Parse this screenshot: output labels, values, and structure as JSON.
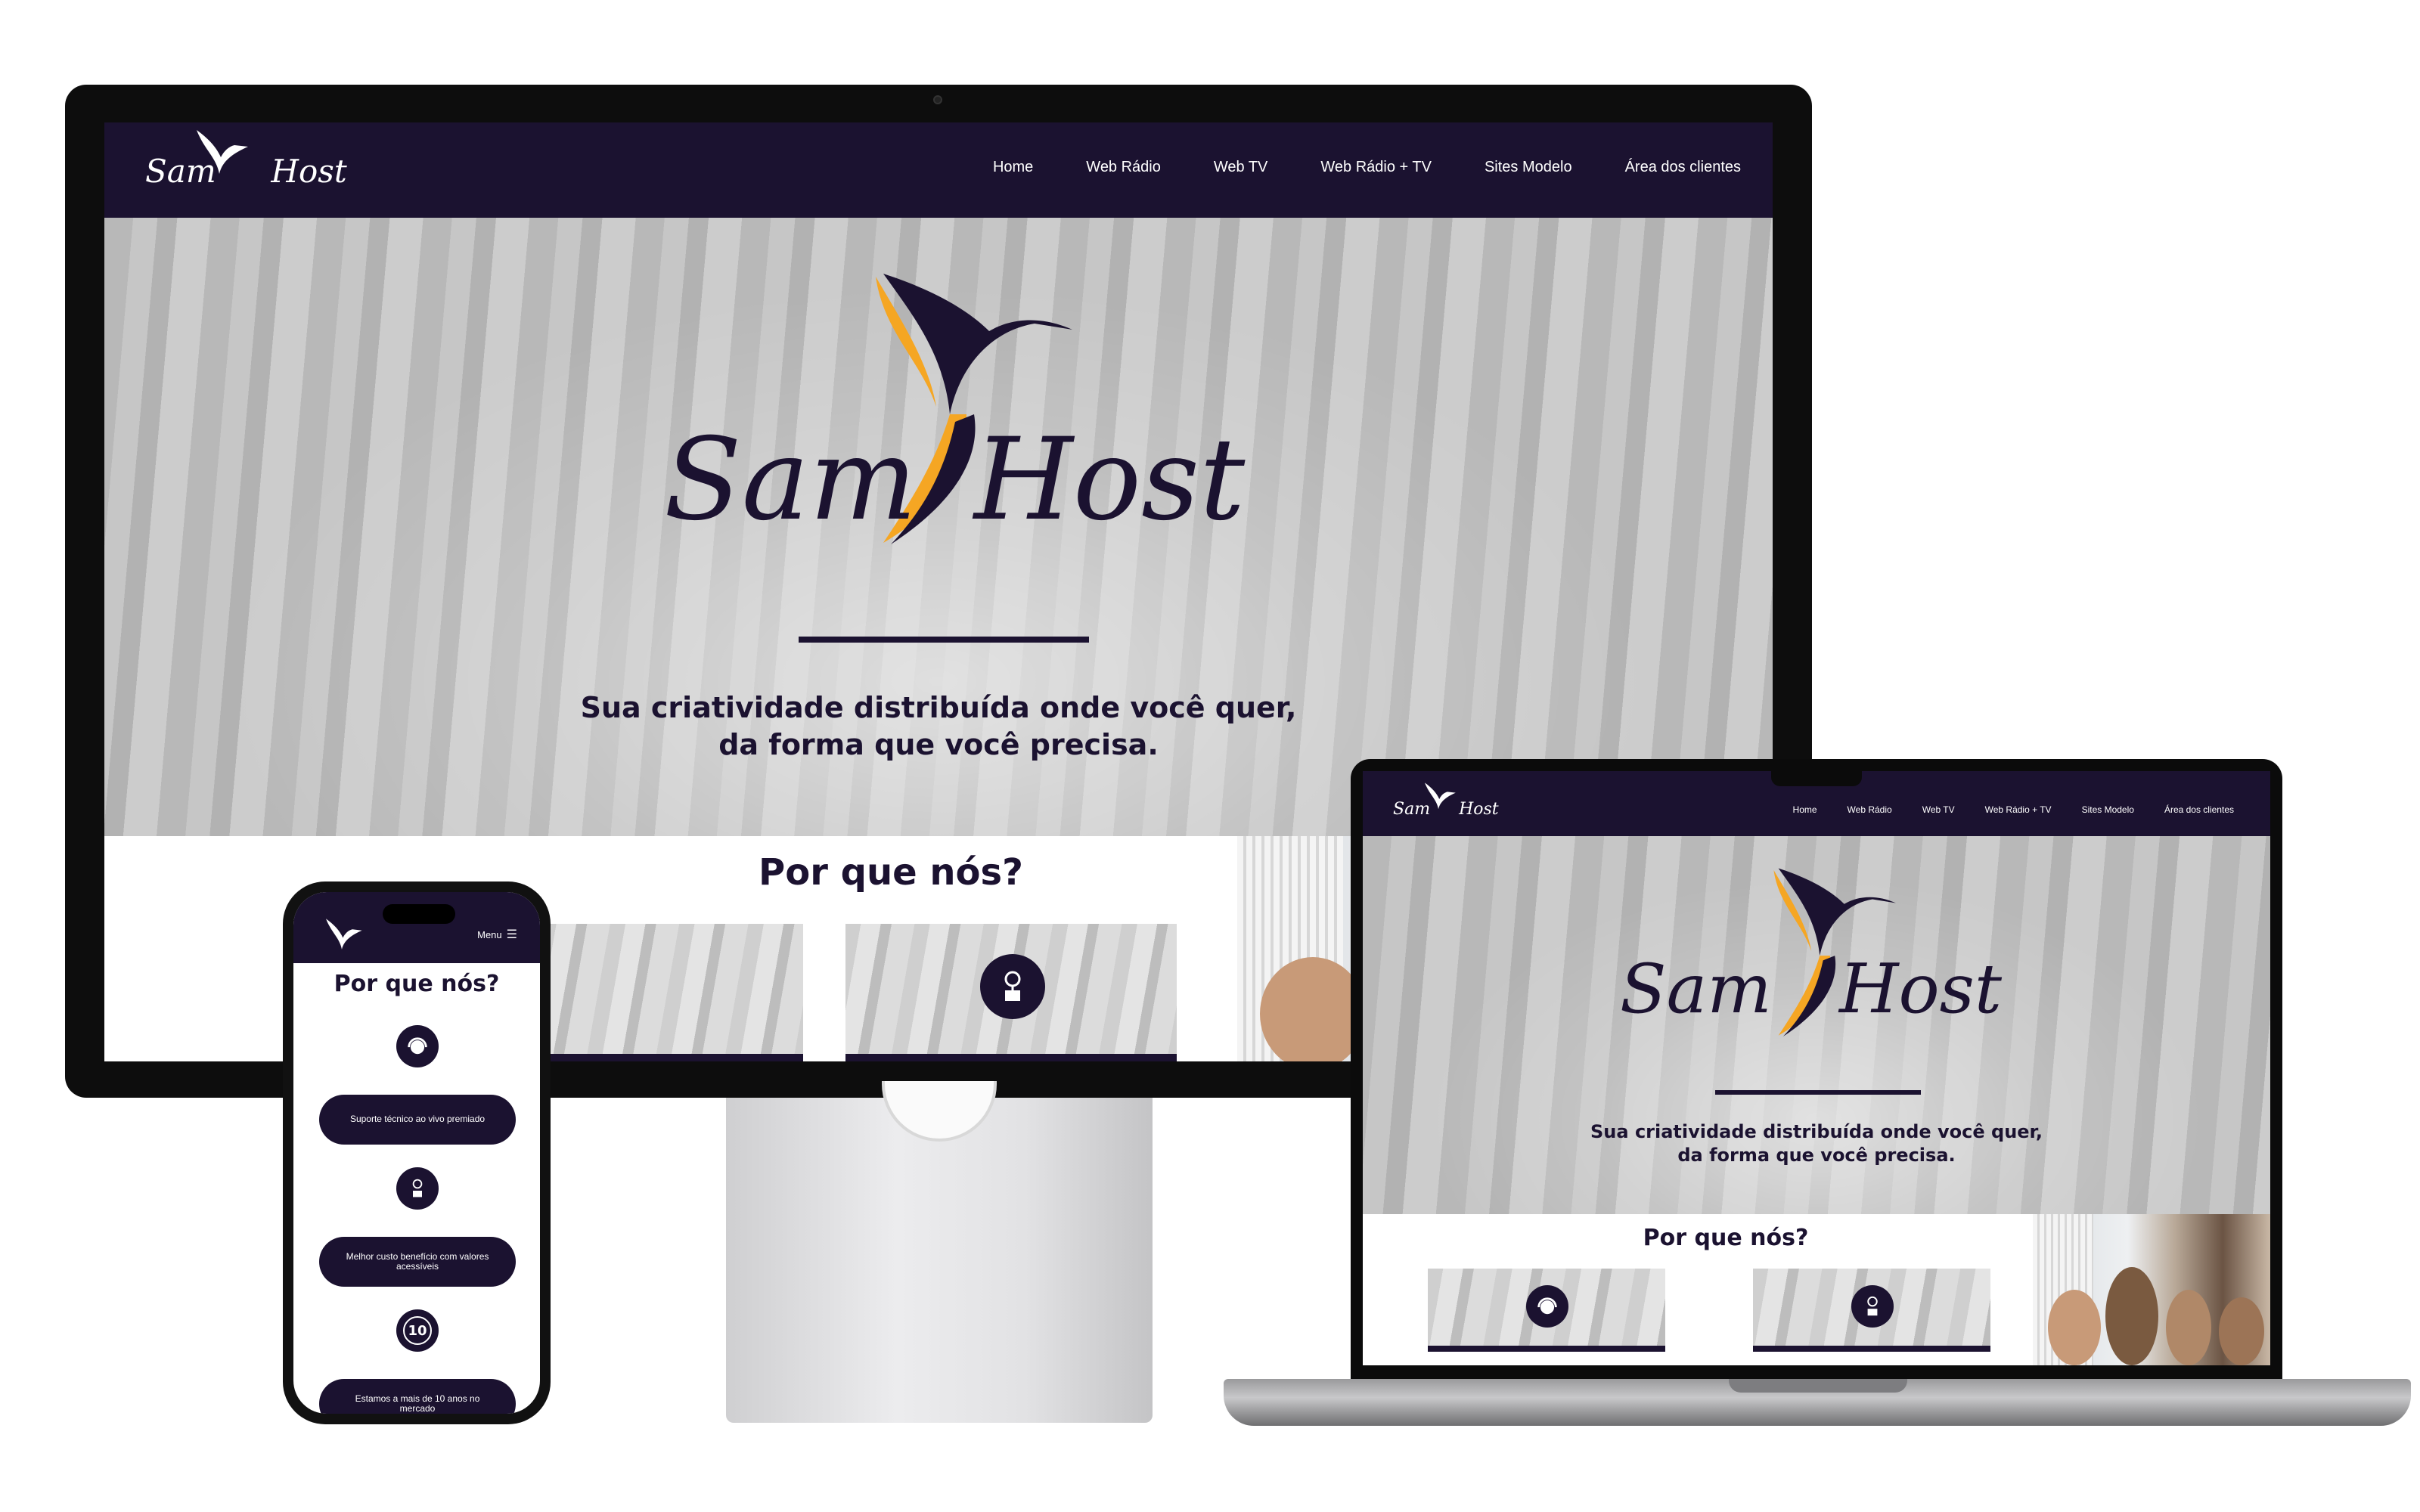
{
  "brand": {
    "name_left": "Sam",
    "name_right": "Host",
    "colors": {
      "navy": "#1b1230",
      "gold": "#f5a623",
      "white": "#ffffff"
    }
  },
  "nav": {
    "items": [
      "Home",
      "Web Rádio",
      "Web TV",
      "Web Rádio + TV",
      "Sites Modelo",
      "Área dos clientes"
    ]
  },
  "hero": {
    "tagline_line1": "Sua criatividade distribuída onde você quer,",
    "tagline_line2": "da forma que você precisa."
  },
  "why": {
    "title": "Por que nós?",
    "icons": [
      "headset-icon",
      "money-plant-icon",
      "ten-years-icon"
    ]
  },
  "mobile": {
    "menu_label": "Menu",
    "why_title": "Por que nós?",
    "features": [
      {
        "icon": "headset-icon",
        "label": "Suporte técnico ao vivo premiado"
      },
      {
        "icon": "money-plant-icon",
        "label": "Melhor custo benefício com valores acessíveis"
      },
      {
        "icon": "ten-years-icon",
        "label": "Estamos a mais de 10 anos no mercado"
      }
    ]
  }
}
